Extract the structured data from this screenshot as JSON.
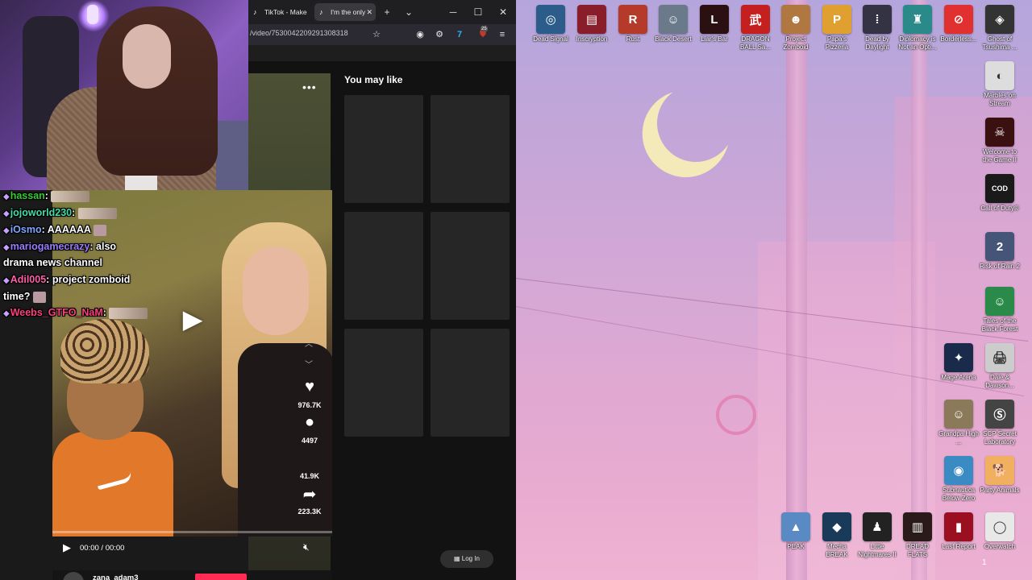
{
  "browser": {
    "tabs": [
      {
        "label": "TikTok - Make",
        "icon": "tiktok-icon"
      },
      {
        "label": "I'm the only",
        "icon": "tiktok-icon",
        "active": true
      }
    ],
    "tab_close": "✕",
    "new_tab": "+",
    "tab_list": "⌄",
    "window_controls": {
      "minimize": "─",
      "maximize": "☐",
      "close": "✕"
    },
    "url": "/video/7530042209291308318",
    "toolbar_icons": [
      "bookmark-star-icon",
      "account-icon",
      "extensions-icon",
      "seventv-extension-icon",
      "ublock-extension-icon",
      "menu-icon"
    ],
    "ublock_count": "25"
  },
  "tiktok": {
    "more_label": "•••",
    "you_may_like": "You may like",
    "login_label": "Log In",
    "play_glyph": "▶",
    "likes": "976.7K",
    "comments": "4497",
    "saves": "41.9K",
    "shares": "223.3K",
    "time": "00:00 / 00:00",
    "progress": 0,
    "author": "zana_adam3"
  },
  "chat": [
    {
      "user": "hassan",
      "color": "#33cc33",
      "text": "",
      "has_emote": true
    },
    {
      "user": "jojoworld230",
      "color": "#44ddaa",
      "text": "",
      "has_emote": true
    },
    {
      "user": "iOsmo",
      "color": "#7fa8ff",
      "text": "AAAAAA",
      "has_emote": true
    },
    {
      "user": "mariogamecrazy",
      "color": "#9b7cff",
      "text": "also",
      "has_emote": false
    },
    {
      "user": "",
      "color": "#ffffff",
      "text": "drama news channel",
      "has_emote": false
    },
    {
      "user": "Adil005",
      "color": "#ff5fa8",
      "text": "project zomboid",
      "has_emote": false
    },
    {
      "user": "",
      "color": "#ffffff",
      "text": "time?",
      "has_emote": true
    },
    {
      "user": "Weebs_GTFO_NaM",
      "color": "#ff3d7f",
      "text": "",
      "has_emote": true
    }
  ],
  "desktop_icons": [
    {
      "label": "Dead Signal",
      "color": "#2b5c8a",
      "glyph": "◎"
    },
    {
      "label": "Inscryption",
      "color": "#8a1d2a",
      "glyph": "▤"
    },
    {
      "label": "Rust",
      "color": "#b53a2a",
      "glyph": "R"
    },
    {
      "label": "Black Desert",
      "color": "#6a7a8a",
      "glyph": "☺"
    },
    {
      "label": "Liar's Bar",
      "color": "#2a1010",
      "glyph": "L"
    },
    {
      "label": "DRAGON BALL Sa...",
      "color": "#c42020",
      "glyph": "武"
    },
    {
      "label": "Project Zomboid",
      "color": "#b07840",
      "glyph": "☻"
    },
    {
      "label": "Papa's Pizzeria",
      "color": "#e0a030",
      "glyph": "P"
    },
    {
      "label": "Dead by Daylight",
      "color": "#333344",
      "glyph": "⁞"
    },
    {
      "label": "Diplomacy is Not an Opti...",
      "color": "#2a8a8a",
      "glyph": "♜"
    },
    {
      "label": "Borderless...",
      "color": "#e03030",
      "glyph": "⊘"
    },
    {
      "label": "Ghost of Tsushima ...",
      "color": "#333333",
      "glyph": "◈"
    },
    {
      "label": "Marbles on Stream",
      "color": "#dddddd",
      "glyph": "◐"
    },
    {
      "label": "Welcome to the Game II",
      "color": "#3a1010",
      "glyph": "☠"
    },
    {
      "label": "Call of Duty®",
      "color": "#1a1a1a",
      "glyph": "COD"
    },
    {
      "label": "Risk of Rain 2",
      "color": "#445577",
      "glyph": "2"
    },
    {
      "label": "Tales of the Black Forest",
      "color": "#2a8a4a",
      "glyph": "☺"
    },
    {
      "label": "Mage Arena",
      "color": "#1a2a4a",
      "glyph": "✦"
    },
    {
      "label": "Dale & Dawson...",
      "color": "#cccccc",
      "glyph": "🖨"
    },
    {
      "label": "Grandpa High ...",
      "color": "#8a7a5a",
      "glyph": "☺"
    },
    {
      "label": "SCP Secret Laboratory",
      "color": "#444444",
      "glyph": "Ⓢ"
    },
    {
      "label": "Subnautica Below Zero",
      "color": "#3a8ac4",
      "glyph": "◉"
    },
    {
      "label": "Party Animals",
      "color": "#f0b060",
      "glyph": "🐕"
    },
    {
      "label": "PEAK",
      "color": "#5a8ac4",
      "glyph": "▲"
    },
    {
      "label": "Mecha BREAK",
      "color": "#1a3a5a",
      "glyph": "◆"
    },
    {
      "label": "Little Nightmares II",
      "color": "#222222",
      "glyph": "♟"
    },
    {
      "label": "DREAD FLATS",
      "color": "#2a1a1a",
      "glyph": "▥"
    },
    {
      "label": "Last Report",
      "color": "#9a1020",
      "glyph": "▮"
    },
    {
      "label": "Overwatch",
      "color": "#e8e8e8",
      "glyph": "◯"
    }
  ],
  "page_indicator": "1"
}
